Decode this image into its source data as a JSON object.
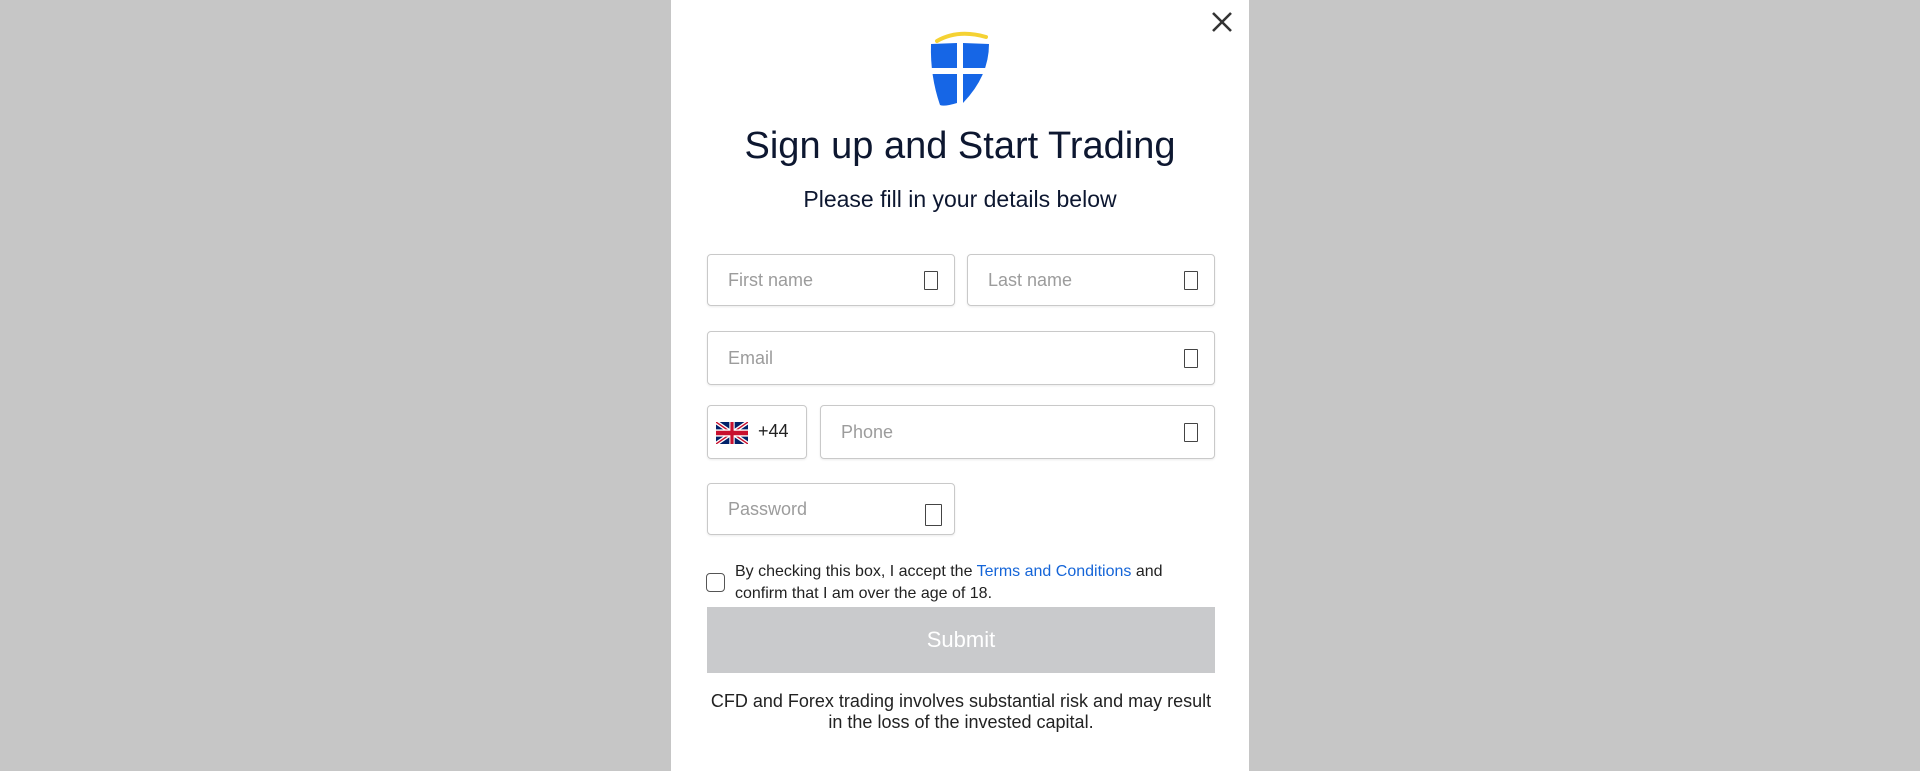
{
  "modal": {
    "title": "Sign up and Start Trading",
    "subtitle": "Please fill in your details below"
  },
  "form": {
    "first_name_placeholder": "First name",
    "last_name_placeholder": "Last name",
    "email_placeholder": "Email",
    "country_code": "+44",
    "country_flag": "uk-flag-icon",
    "phone_placeholder": "Phone",
    "password_placeholder": "Password"
  },
  "consent": {
    "prefix": "By checking this box, I accept the ",
    "link_text": "Terms and Conditions",
    "suffix": " and confirm that I am over the age of 18."
  },
  "submit_label": "Submit",
  "risk_warning": "CFD and Forex trading involves substantial risk and may result in the loss of the invested capital.",
  "colors": {
    "backdrop": "#c6c6c6",
    "logo_blue": "#1666e6",
    "logo_yellow": "#f5d233",
    "link": "#1565d8",
    "submit_disabled": "#c9cacc"
  }
}
